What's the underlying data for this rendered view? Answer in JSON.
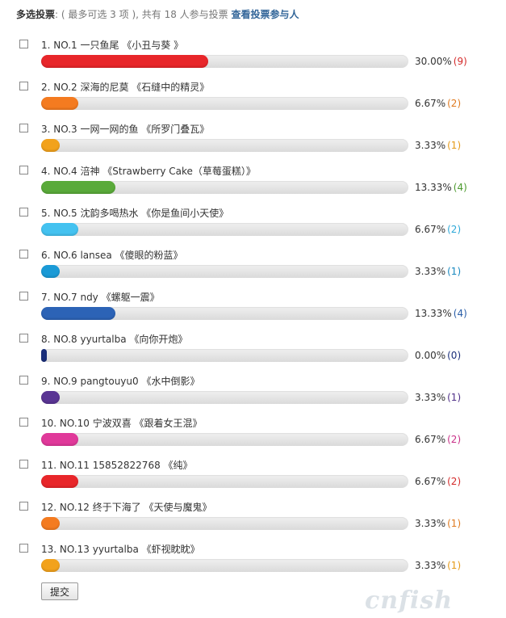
{
  "header": {
    "title": "多选投票",
    "limit_text": ": ( 最多可选 3 项 ), 共有 18 人参与投票",
    "view_voters_link": "查看投票参与人"
  },
  "options": [
    {
      "label": "1.  NO.1 一只鱼尾 《小丑与葵 》",
      "percent_text": "30.00%",
      "count_text": "(9)",
      "percent": 30.0,
      "fill_color": "#e8262a",
      "count_color": "#d42a2a"
    },
    {
      "label": "2.  NO.2 深海的尼莫 《石缝中的精灵》",
      "percent_text": "6.67%",
      "count_text": "(2)",
      "percent": 6.67,
      "fill_color": "#f47b20",
      "count_color": "#e07a1f"
    },
    {
      "label": "3.  NO.3 一网一网的鱼 《所罗门叠瓦》",
      "percent_text": "3.33%",
      "count_text": "(1)",
      "percent": 3.33,
      "fill_color": "#f2a21c",
      "count_color": "#e59a18"
    },
    {
      "label": "4.  NO.4 涪神 《Strawberry Cake（草莓蛋糕）》",
      "percent_text": "13.33%",
      "count_text": "(4)",
      "percent": 13.33,
      "fill_color": "#5aaa3a",
      "count_color": "#4c9a2e"
    },
    {
      "label": "5.  NO.5 沈韵多喝热水 《你是鱼间小天使》",
      "percent_text": "6.67%",
      "count_text": "(2)",
      "percent": 6.67,
      "fill_color": "#44c2f0",
      "count_color": "#2ea8d8"
    },
    {
      "label": "6.  NO.6 lansea 《傻眼的粉蓝》",
      "percent_text": "3.33%",
      "count_text": "(1)",
      "percent": 3.33,
      "fill_color": "#1a9ad6",
      "count_color": "#1788c0"
    },
    {
      "label": "7.  NO.7 ndy 《螺躯一震》",
      "percent_text": "13.33%",
      "count_text": "(4)",
      "percent": 13.33,
      "fill_color": "#2c63b6",
      "count_color": "#2a5ea8"
    },
    {
      "label": "8.  NO.8 yyurtalba 《向你开炮》",
      "percent_text": "0.00%",
      "count_text": "(0)",
      "percent": 0.0,
      "fill_color": "#1a2e7a",
      "count_color": "#1a2e7a"
    },
    {
      "label": "9.  NO.9 pangtouyu0 《水中倒影》",
      "percent_text": "3.33%",
      "count_text": "(1)",
      "percent": 3.33,
      "fill_color": "#5a3594",
      "count_color": "#4f2f88"
    },
    {
      "label": "10.  NO.10 宁波双喜 《跟着女王混》",
      "percent_text": "6.67%",
      "count_text": "(2)",
      "percent": 6.67,
      "fill_color": "#e0399a",
      "count_color": "#c93088"
    },
    {
      "label": "11.  NO.11 15852822768 《纯》",
      "percent_text": "6.67%",
      "count_text": "(2)",
      "percent": 6.67,
      "fill_color": "#e8262a",
      "count_color": "#d42a2a"
    },
    {
      "label": "12.  NO.12 终于下海了 《天使与魔鬼》",
      "percent_text": "3.33%",
      "count_text": "(1)",
      "percent": 3.33,
      "fill_color": "#f47b20",
      "count_color": "#e07a1f"
    },
    {
      "label": "13.  NO.13 yyurtalba 《虾视眈眈》",
      "percent_text": "3.33%",
      "count_text": "(1)",
      "percent": 3.33,
      "fill_color": "#f2a21c",
      "count_color": "#e59a18"
    }
  ],
  "submit_label": "提交",
  "watermark_text": "cnfish"
}
